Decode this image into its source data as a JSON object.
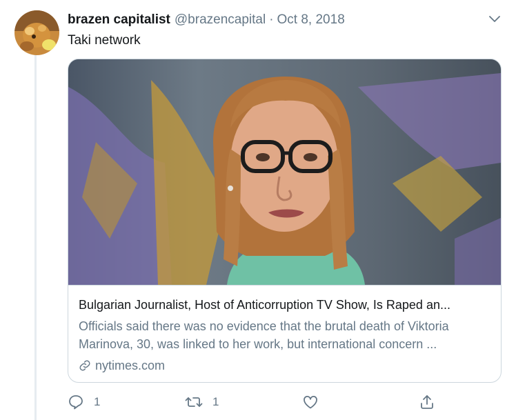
{
  "tweet": {
    "author": {
      "display_name": "brazen capitalist",
      "handle": "@brazencapital"
    },
    "separator": "·",
    "date": "Oct 8, 2018",
    "text": "Taki network",
    "card": {
      "title": "Bulgarian Journalist, Host of Anticorruption TV Show, Is Raped an...",
      "description": "Officials said there was no evidence that the brutal death of Viktoria Marinova, 30, was linked to her work, but international concern ...",
      "domain": "nytimes.com",
      "link_icon": "link-icon"
    },
    "actions": {
      "reply": {
        "icon": "reply-icon",
        "count": "1"
      },
      "retweet": {
        "icon": "retweet-icon",
        "count": "1"
      },
      "like": {
        "icon": "heart-icon",
        "count": ""
      },
      "share": {
        "icon": "share-icon"
      }
    },
    "colors": {
      "text_primary": "#14171a",
      "text_secondary": "#657786",
      "border": "#ccd6dd",
      "thread_line": "#e6ecf0"
    }
  }
}
